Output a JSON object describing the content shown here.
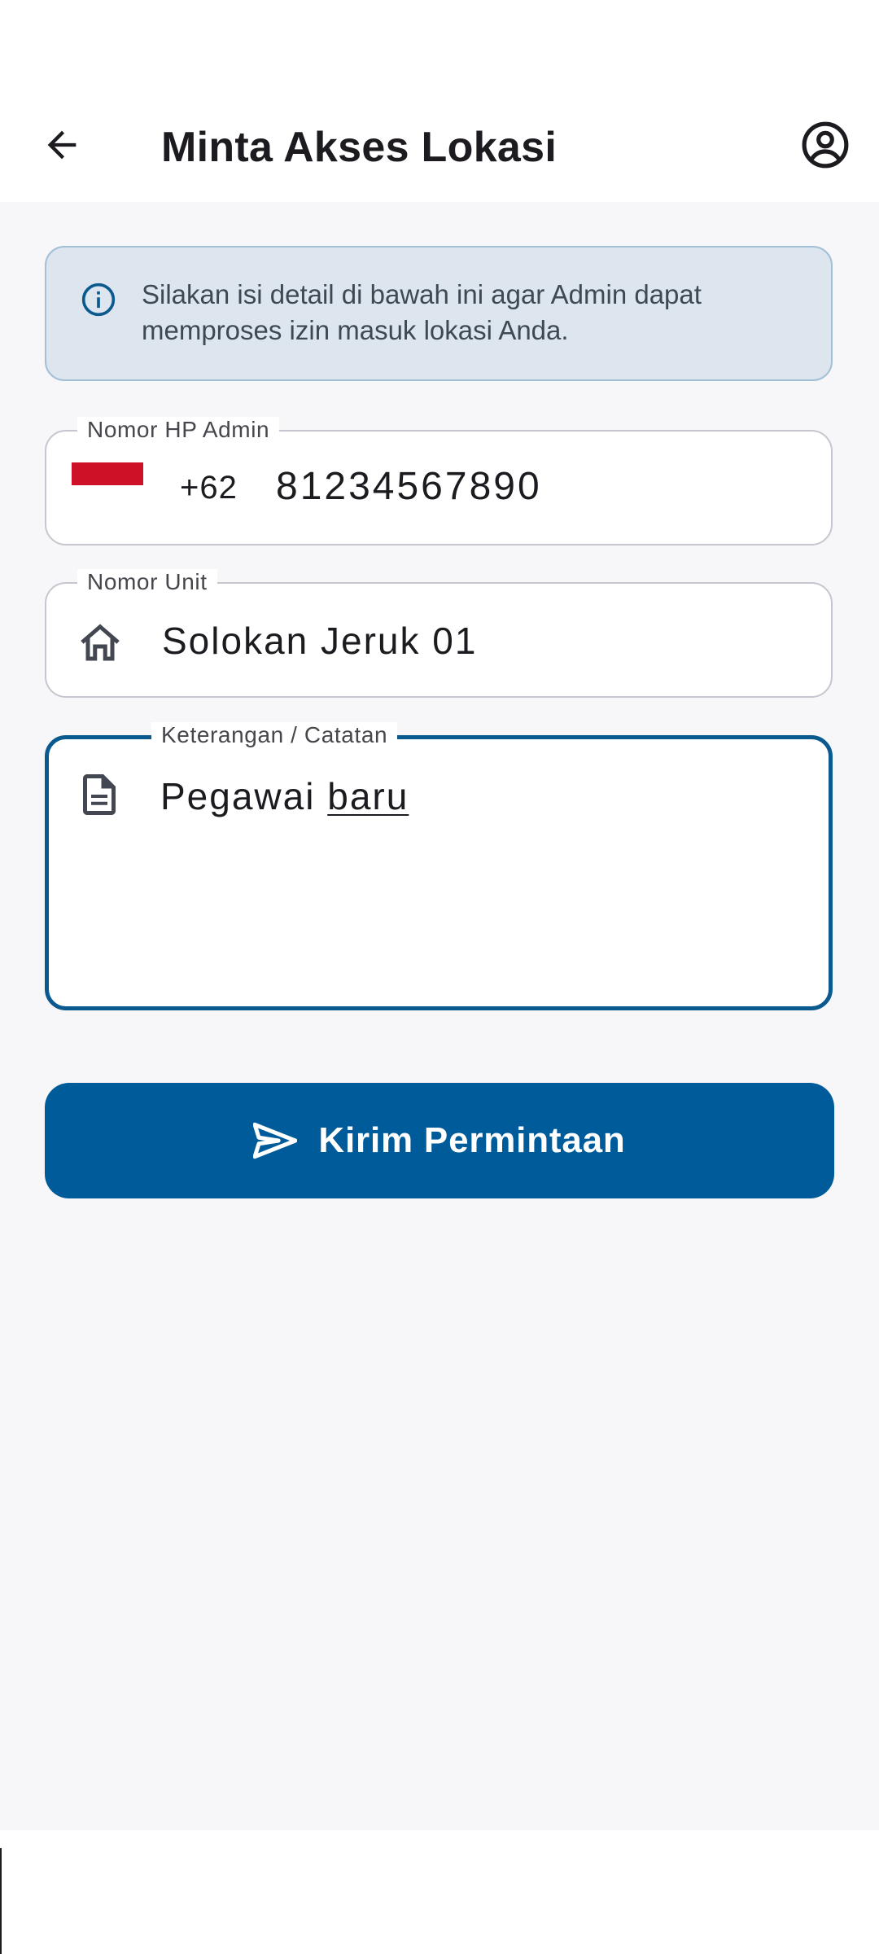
{
  "app_bar": {
    "title": "Minta Akses Lokasi",
    "back_icon": "arrow-left-icon",
    "account_icon": "account-circle-icon"
  },
  "info_banner": {
    "icon": "info-icon",
    "text": "Silakan isi detail di bawah ini agar Admin dapat memproses izin masuk lokasi Anda."
  },
  "form": {
    "phone": {
      "label": "Nomor HP Admin",
      "country_flag": "indonesia-flag-icon",
      "dial_code": "+62",
      "value": "81234567890"
    },
    "unit": {
      "label": "Nomor Unit",
      "icon": "home-icon",
      "value": "Solokan Jeruk 01"
    },
    "note": {
      "label": "Keterangan / Catatan",
      "icon": "document-icon",
      "value_plain": "Pegawai ",
      "value_composing": "baru"
    }
  },
  "submit": {
    "icon": "send-icon",
    "label": "Kirim Permintaan"
  },
  "colors": {
    "primary": "#005b9a",
    "focus_border": "#0b5a8f",
    "banner_bg": "#dde6ef",
    "banner_border": "#a3bfd6",
    "page_bg": "#f7f7f9",
    "flag_red": "#ce1126"
  }
}
